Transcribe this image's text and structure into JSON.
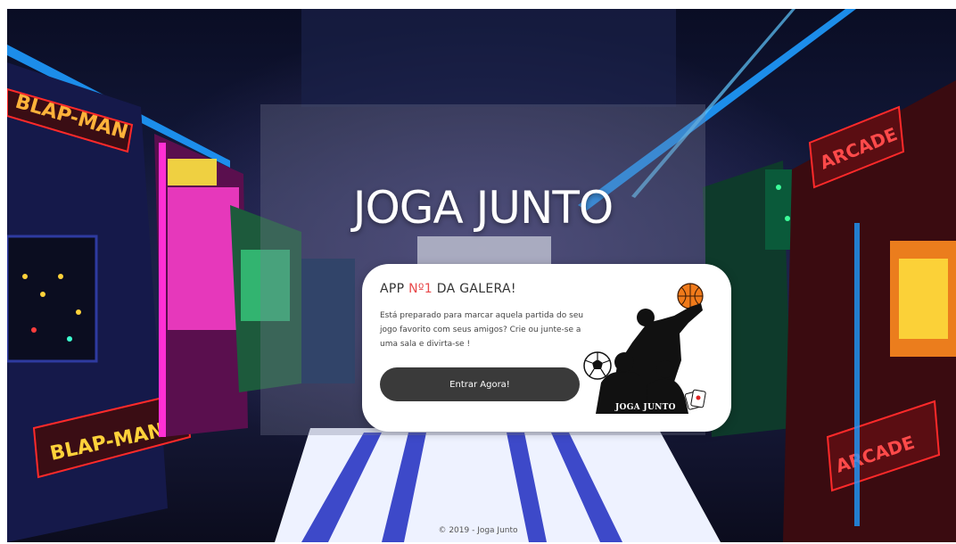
{
  "hero": {
    "title": "JOGA JUNTO"
  },
  "card": {
    "title_prefix": "APP ",
    "title_accent": "Nº1",
    "title_suffix": " DA GALERA!",
    "description": "Está preparado para marcar aquela partida do seu jogo favorito com seus amigos? Crie ou junte-se a uma sala e divirta-se !",
    "button_label": "Entrar Agora!",
    "logo_text": "JOGA JUNTO"
  },
  "footer": {
    "text": "© 2019 - Joga Junto"
  },
  "arcade_signs": {
    "left_top": "BLAP-MAN",
    "left_bottom": "BLAP-MAN",
    "right_top": "ARCADE",
    "right_bottom": "ARCADE"
  },
  "colors": {
    "accent": "#e8494b",
    "button": "#3a3a3a",
    "neon_blue": "#1e9bff",
    "neon_pink": "#ff2fd4",
    "neon_red": "#ff2a2a"
  }
}
